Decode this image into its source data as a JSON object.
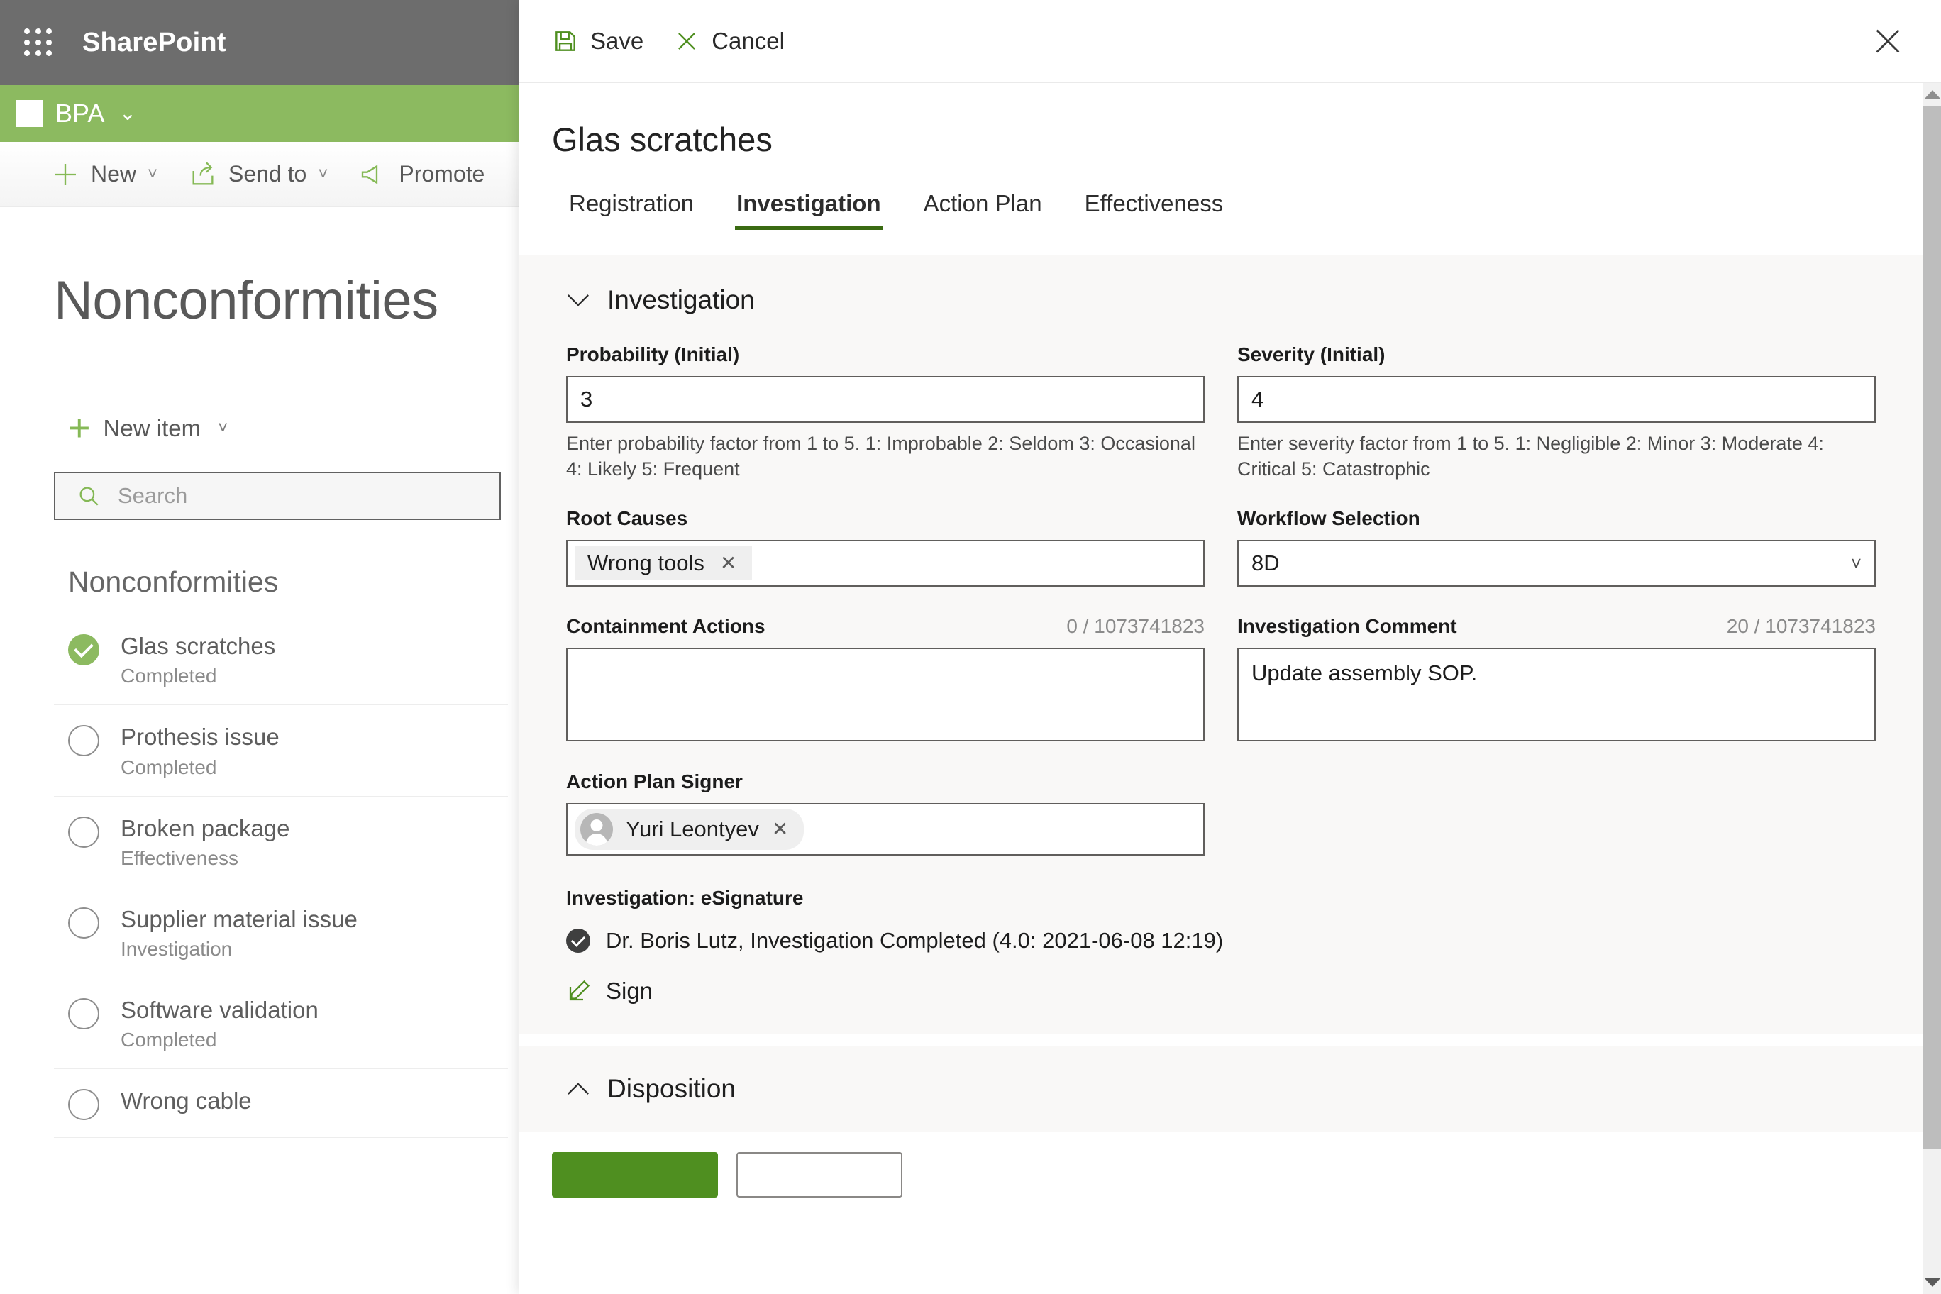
{
  "suite": {
    "app_launcher": "waffle-icon",
    "title": "SharePoint"
  },
  "site": {
    "name": "BPA",
    "chevron": "chevron-double-down-icon"
  },
  "command_bar": [
    {
      "label": "New",
      "icon": "plus-icon",
      "has_chevron": true
    },
    {
      "label": "Send to",
      "icon": "share-icon",
      "has_chevron": true
    },
    {
      "label": "Promote",
      "icon": "megaphone-icon",
      "has_chevron": false
    }
  ],
  "page": {
    "title": "Nonconformities",
    "new_item_label": "New item",
    "search_placeholder": "Search",
    "search_value": "",
    "list_heading": "Nonconformities"
  },
  "list_items": [
    {
      "title": "Glas scratches",
      "status": "Completed",
      "selected": true
    },
    {
      "title": "Prothesis issue",
      "status": "Completed",
      "selected": false
    },
    {
      "title": "Broken package",
      "status": "Effectiveness",
      "selected": false
    },
    {
      "title": "Supplier material issue",
      "status": "Investigation",
      "selected": false
    },
    {
      "title": "Software validation",
      "status": "Completed",
      "selected": false
    },
    {
      "title": "Wrong cable",
      "status": "",
      "selected": false
    }
  ],
  "panel": {
    "save_label": "Save",
    "cancel_label": "Cancel",
    "close_icon": "close-icon",
    "record_title": "Glas scratches",
    "tabs": [
      {
        "label": "Registration",
        "active": false
      },
      {
        "label": "Investigation",
        "active": true
      },
      {
        "label": "Action Plan",
        "active": false
      },
      {
        "label": "Effectiveness",
        "active": false
      }
    ],
    "investigation": {
      "section_title": "Investigation",
      "probability": {
        "label": "Probability (Initial)",
        "value": "3",
        "hint": "Enter probability factor from 1 to 5. 1: Improbable 2: Seldom 3: Occasional 4: Likely 5: Frequent"
      },
      "severity": {
        "label": "Severity (Initial)",
        "value": "4",
        "hint": "Enter severity factor from 1 to 5. 1: Negligible 2: Minor 3: Moderate 4: Critical 5: Catastrophic"
      },
      "root_causes": {
        "label": "Root Causes",
        "chips": [
          "Wrong tools"
        ]
      },
      "workflow_selection": {
        "label": "Workflow Selection",
        "value": "8D"
      },
      "containment_actions": {
        "label": "Containment Actions",
        "counter": "0 / 1073741823",
        "value": ""
      },
      "investigation_comment": {
        "label": "Investigation Comment",
        "counter": "20 / 1073741823",
        "value": "Update assembly SOP."
      },
      "action_plan_signer": {
        "label": "Action Plan Signer",
        "chips": [
          "Yuri Leontyev"
        ]
      },
      "esignature": {
        "label": "Investigation: eSignature",
        "entry": "Dr. Boris Lutz, Investigation Completed (4.0: 2021-06-08 12:19)",
        "sign_label": "Sign"
      }
    },
    "disposition": {
      "section_title": "Disposition"
    }
  },
  "colors": {
    "suite_bar": "#6d6d6d",
    "site_bar": "#8cba60",
    "accent_green": "#4f8f20",
    "link_green": "#85b955",
    "tab_underline": "#3a6b12"
  }
}
